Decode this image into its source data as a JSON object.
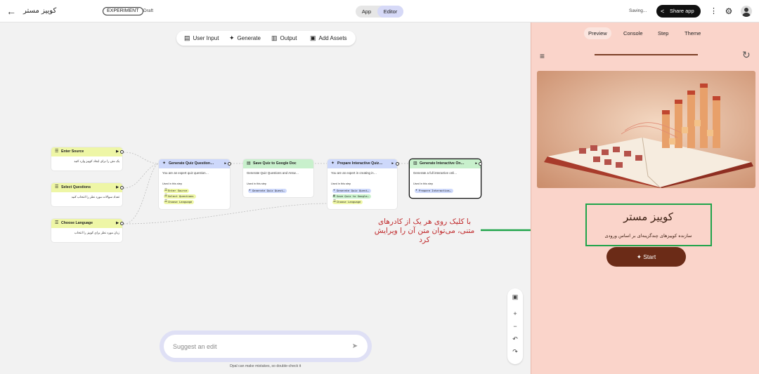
{
  "header": {
    "app_title": "کوییز مستر",
    "badge": "EXPERIMENT",
    "status": "Draft",
    "mode_app": "App",
    "mode_editor": "Editor",
    "saving": "Saving...",
    "share_label": "Share app"
  },
  "toolbar": {
    "user_input": "User Input",
    "generate": "Generate",
    "output": "Output",
    "add_assets": "Add Assets"
  },
  "nodes": {
    "enter_source": {
      "title": "Enter Source",
      "desc": "یک متن را برای ایجاد کوییز وارد کنید"
    },
    "select_questions": {
      "title": "Select Questions",
      "desc": "تعداد سوالات مورد نظر را انتخاب کنید"
    },
    "choose_language": {
      "title": "Choose Language",
      "desc": "زبان مورد نظر برای کوییز را انتخاب"
    },
    "gen_quiz": {
      "title": "Generate Quiz Question…",
      "desc": "You are an expert quiz question…",
      "used": "Used in this step",
      "chips": [
        "Enter Source",
        "Select Questions",
        "Choose Language"
      ]
    },
    "save_quiz": {
      "title": "Save Quiz to Google Doc",
      "desc": "Generate Quiz Questions and Answ…",
      "used": "Used in this step",
      "chips": [
        "Generate Quiz Quest…"
      ]
    },
    "prepare": {
      "title": "Prepare Interactive Quiz…",
      "desc": "You are an expert in creating in…",
      "used": "Used in this step",
      "chips": [
        "Generate Quiz Quest…",
        "Save Quiz to Google…",
        "Choose Language"
      ]
    },
    "gen_interactive": {
      "title": "Generate Interactive On…",
      "desc": "Generate a full interactive onli…",
      "used": "Used in this step",
      "chips": [
        "Prepare Interactive…"
      ]
    }
  },
  "annotation": "با کلیک روی هر یک از کادرهای متنی، می‌توان متن آن را ویرایش کرد",
  "suggest": {
    "placeholder": "Suggest an edit"
  },
  "footnote": "Opal can make mistakes, so double-check it",
  "preview": {
    "tabs": [
      "Preview",
      "Console",
      "Step",
      "Theme"
    ],
    "active_tab": "Preview",
    "quiz_title": "کوییز مستر",
    "quiz_subtitle": "سازنده کوییزهای چندگزینه‌ای بر اساس ورودی",
    "start_label": "Start"
  },
  "colors": {
    "input_node": "#eef6a6",
    "generate_node": "#cdd8fb",
    "output_node": "#c8f0cc",
    "accent": "#d6d9f7",
    "preview_bg": "#fad4ca",
    "start_button": "#6b2b17",
    "annotation": "#c0292b",
    "arrow": "#1fa44a"
  },
  "icons": {
    "back": "arrow-left-icon",
    "share": "share-icon",
    "more": "more-vert-icon",
    "settings": "gear-icon",
    "user": "account-icon",
    "send": "send-icon",
    "spark": "spark-icon"
  }
}
